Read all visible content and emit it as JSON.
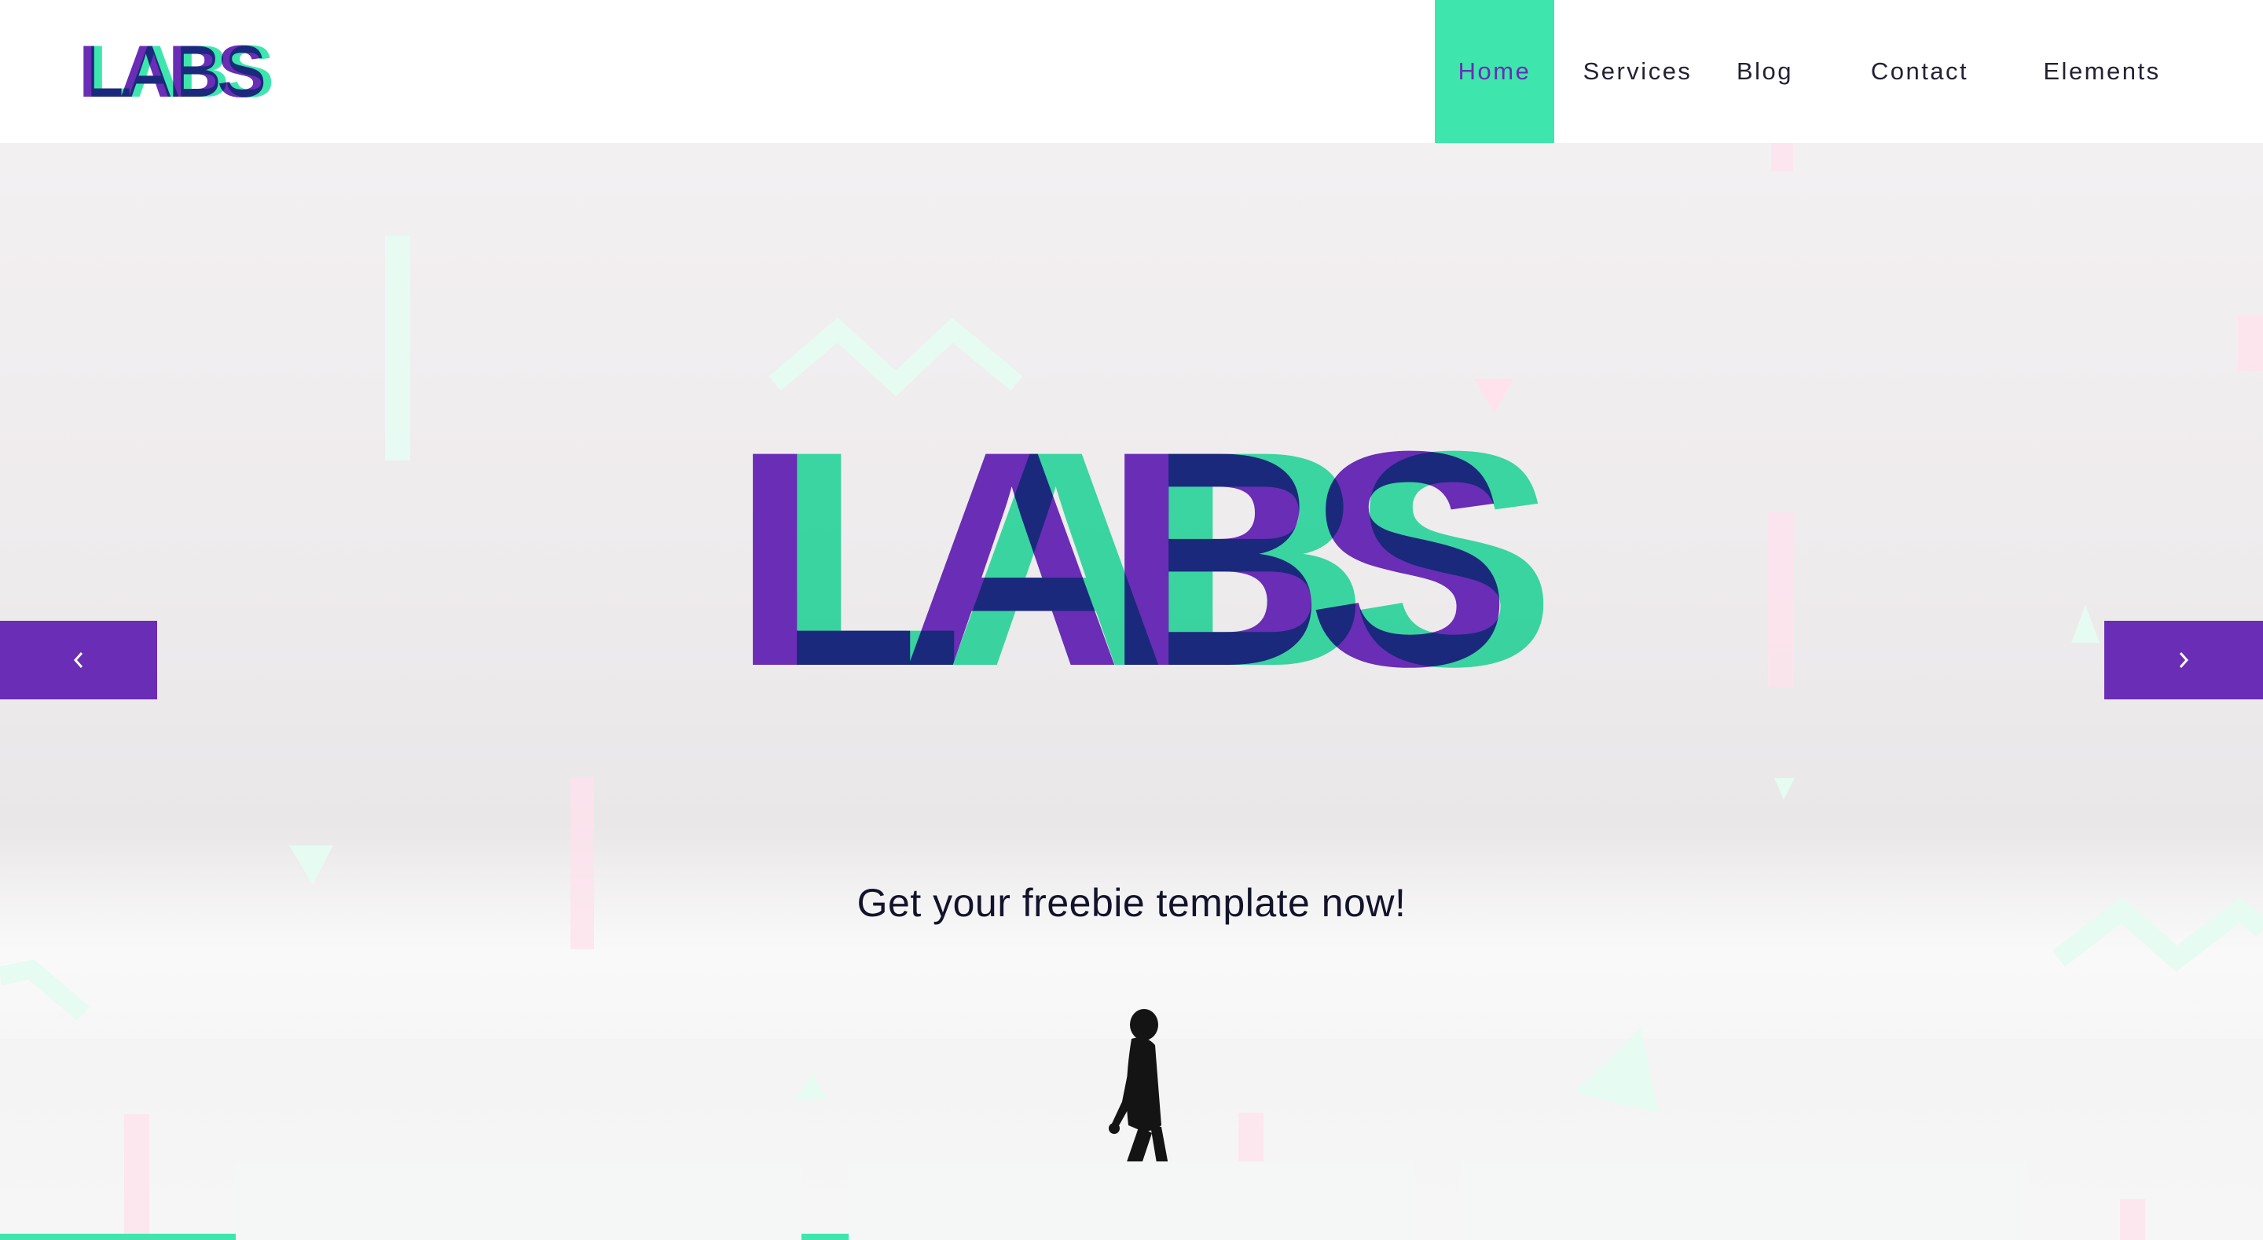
{
  "header": {
    "logo_text": "LABS",
    "nav": [
      {
        "label": "Home",
        "active": true
      },
      {
        "label": "Services",
        "active": false
      },
      {
        "label": "Blog",
        "active": false
      },
      {
        "label": "Contact",
        "active": false
      },
      {
        "label": "Elements",
        "active": false
      }
    ]
  },
  "hero": {
    "logo_text": "LABS",
    "tagline": "Get your freebie template now!",
    "prev_icon": "chevron-left-icon",
    "next_icon": "chevron-right-icon"
  },
  "cards": [
    {
      "name": "feature-card-1"
    },
    {
      "name": "feature-card-2"
    },
    {
      "name": "feature-card-3"
    }
  ],
  "colors": {
    "purple": "#6a2db5",
    "green": "#3ee6ad",
    "dark_text": "#13132b",
    "header_bg": "#ffffff"
  }
}
